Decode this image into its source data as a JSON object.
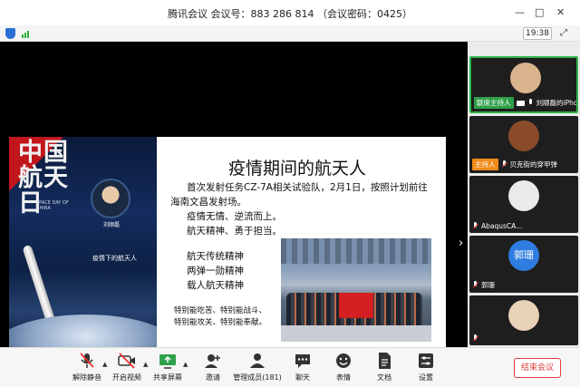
{
  "window": {
    "title": "腾讯会议  会议号：883 286 814  （会议密码：0425）",
    "controls": [
      "—",
      "□",
      "✕"
    ]
  },
  "status": {
    "time": "19:38"
  },
  "slide": {
    "title": "疫情期间的航天人",
    "poster": {
      "big_text": "中国航天日",
      "space_text": "SPACE DAY OF CHINA",
      "person": "刘顺磊",
      "label": "疫情下的航天人"
    },
    "paragraph_lines": [
      "首次发射任务CZ-7A相关试验队，2月1日，按照计划前往",
      "海南文昌发射场。"
    ],
    "motto_lines": [
      "疫情无情、逆流而上。",
      "航天精神、勇于担当。"
    ],
    "spirit_lines": [
      "航天传统精神",
      "两弹一勋精神",
      "载人航天精神"
    ],
    "special_lines": [
      "特别能吃苦、特别能战斗、",
      "特别能攻关、特别能奉献。"
    ]
  },
  "participants": [
    {
      "tag": "联席主持人",
      "tag_color": "#2fa14a",
      "name": "刘顺磊的iPhone",
      "avatar_color": "#d9b48c",
      "active": true,
      "muted": false
    },
    {
      "tag": "主持人",
      "tag_color": "#f08a1a",
      "name": "贝克街的穿甲弹",
      "avatar_color": "#8a4b2a",
      "active": false,
      "muted": true
    },
    {
      "tag": "",
      "name": "AbaqusCA...",
      "avatar_color": "#eaeaea",
      "active": false,
      "muted": true
    },
    {
      "tag": "",
      "name": "郭珊",
      "avatar_text": "郭珊",
      "avatar_color": "#2f7de0",
      "active": false,
      "muted": true
    },
    {
      "tag": "",
      "name": "",
      "avatar_color": "#e8d2b8",
      "active": false,
      "muted": true
    }
  ],
  "toolbar": {
    "unmute": "解除静音",
    "start_video": "开启视频",
    "share": "共享屏幕",
    "invite": "邀请",
    "members": "管理成员(181)",
    "chat": "聊天",
    "reactions": "表情",
    "docs": "文档",
    "settings": "设置",
    "end": "结束会议"
  }
}
